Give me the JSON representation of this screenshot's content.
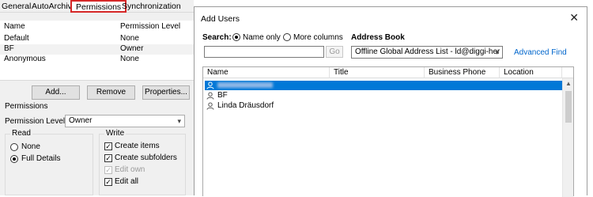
{
  "tabs": [
    "General",
    "AutoArchive",
    "Permissions",
    "Synchronization"
  ],
  "permissions_list": {
    "columns": [
      "Name",
      "Permission Level"
    ],
    "rows": [
      {
        "name": "Default",
        "level": "None"
      },
      {
        "name": "BF",
        "level": "Owner"
      },
      {
        "name": "Anonymous",
        "level": "None"
      }
    ]
  },
  "list_buttons": {
    "add": "Add...",
    "remove": "Remove",
    "properties": "Properties..."
  },
  "permissions_section": {
    "title": "Permissions",
    "level_label": "Permission Level:",
    "level_value": "Owner",
    "read_group": {
      "title": "Read",
      "options": [
        "None",
        "Full Details"
      ],
      "selected": "Full Details"
    },
    "write_group": {
      "title": "Write",
      "items": [
        {
          "label": "Create items",
          "checked": true,
          "disabled": false
        },
        {
          "label": "Create subfolders",
          "checked": true,
          "disabled": false
        },
        {
          "label": "Edit own",
          "checked": true,
          "disabled": true
        },
        {
          "label": "Edit all",
          "checked": true,
          "disabled": false
        }
      ]
    }
  },
  "dialog": {
    "title": "Add Users",
    "close_icon": "close-icon",
    "search_label": "Search:",
    "search_options": [
      "Name only",
      "More columns"
    ],
    "search_selected": "Name only",
    "search_value": "",
    "go_label": "Go",
    "address_book_label": "Address Book",
    "address_book_value": "Offline Global Address List - ld@diggi-her",
    "advanced_find": "Advanced Find",
    "results_columns": [
      "Name",
      "Title",
      "Business Phone",
      "Location"
    ],
    "results": [
      {
        "name": "",
        "selected": true,
        "redacted": true
      },
      {
        "name": "BF",
        "selected": false,
        "redacted": false
      },
      {
        "name": "Linda Dräusdorf",
        "selected": false,
        "redacted": false
      }
    ]
  },
  "colors": {
    "selection": "#0078d7",
    "highlight_border": "#d62828",
    "link": "#0066cc"
  }
}
